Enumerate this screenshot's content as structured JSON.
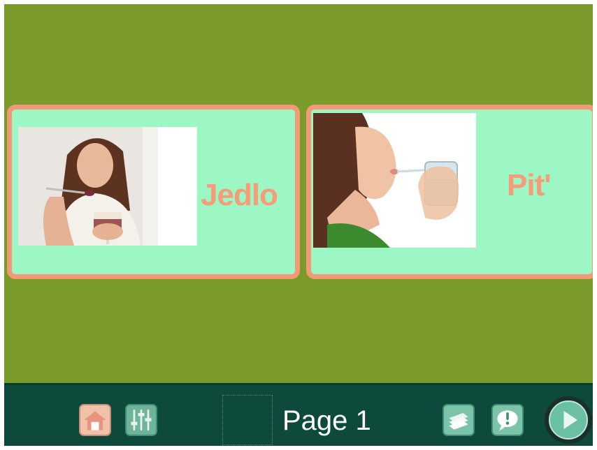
{
  "cards": [
    {
      "label": "Jedlo",
      "image": "woman-eating-photo"
    },
    {
      "label": "Pit'",
      "image": "woman-drinking-photo"
    }
  ],
  "toolbar": {
    "page_label": "Page 1",
    "icons": [
      "home-icon",
      "sliders-icon",
      "cards-stack-icon",
      "speech-bubble-icon",
      "play-icon"
    ]
  },
  "colors": {
    "background": "#7a9a2a",
    "card_fill": "#9cf7c4",
    "card_border": "#f29a78",
    "label_text": "#f59c79",
    "toolbar": "#0e4a3c"
  }
}
